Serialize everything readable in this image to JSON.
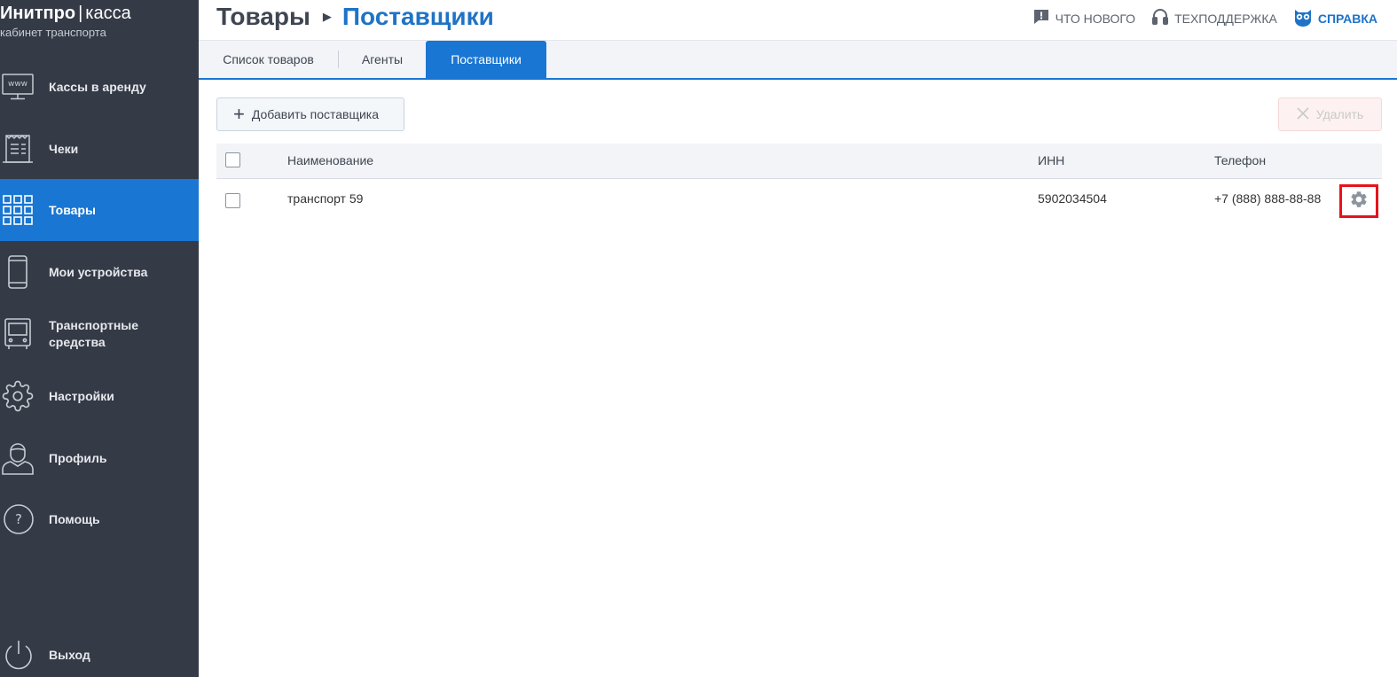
{
  "brand": {
    "name": "Инитпро",
    "separator": "|",
    "product": "касса",
    "subtitle": "кабинет транспорта"
  },
  "sidebar": {
    "items": [
      {
        "label": "Кассы в аренду",
        "icon": "www-monitor-icon"
      },
      {
        "label": "Чеки",
        "icon": "receipt-icon"
      },
      {
        "label": "Товары",
        "icon": "grid-icon",
        "active": true
      },
      {
        "label": "Мои устройства",
        "icon": "phone-icon"
      },
      {
        "label": "Транспортные\nсредства",
        "icon": "bus-icon"
      },
      {
        "label": "Настройки",
        "icon": "gear-icon"
      },
      {
        "label": "Профиль",
        "icon": "user-icon"
      },
      {
        "label": "Помощь",
        "icon": "help-icon"
      },
      {
        "label": "Выход",
        "icon": "power-icon"
      }
    ]
  },
  "header": {
    "breadcrumb": [
      "Товары",
      "Поставщики"
    ],
    "links": [
      {
        "label": "ЧТО НОВОГО",
        "icon": "message-alert-icon"
      },
      {
        "label": "ТЕХПОДДЕРЖКА",
        "icon": "headset-icon"
      },
      {
        "label": "СПРАВКА",
        "icon": "owl-icon"
      }
    ]
  },
  "tabs": [
    {
      "label": "Список товаров"
    },
    {
      "label": "Агенты"
    },
    {
      "label": "Поставщики",
      "active": true
    }
  ],
  "toolbar": {
    "add_label": "Добавить поставщика",
    "delete_label": "Удалить"
  },
  "table": {
    "columns": [
      "Наименование",
      "ИНН",
      "Телефон"
    ],
    "rows": [
      {
        "name": "транспорт 59",
        "inn": "5902034504",
        "phone": "+7 (888) 888-88-88"
      }
    ]
  },
  "colors": {
    "sidebar_bg": "#343a46",
    "accent": "#1976d2",
    "highlight": "#e3151b"
  }
}
